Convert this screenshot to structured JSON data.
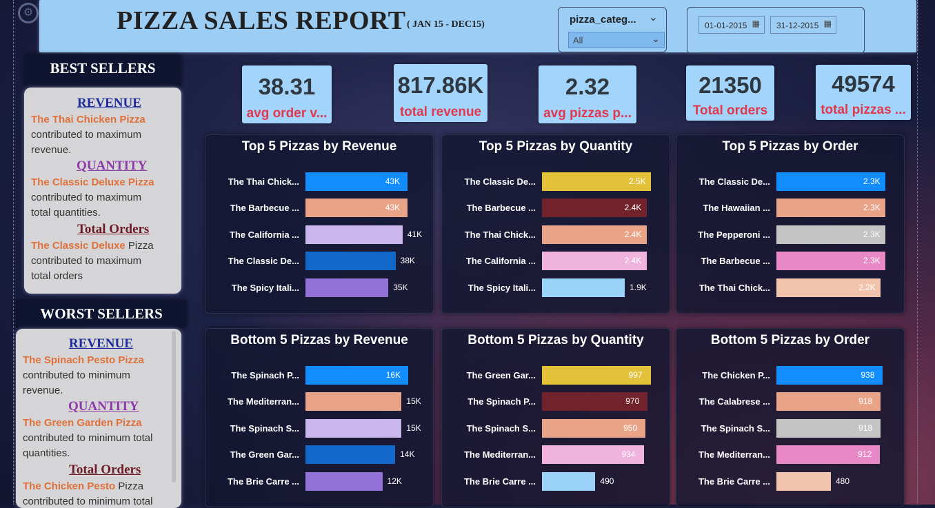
{
  "header": {
    "title": "PIZZA SALES REPORT",
    "subtitle": "( JAN 15 - DEC15)",
    "category_slicer": {
      "label": "pizza_categ...",
      "selected": "All"
    },
    "date_from": "01-01-2015",
    "date_to": "31-12-2015"
  },
  "best_sellers": {
    "heading": "BEST SELLERS",
    "revenue": {
      "title": "REVENUE",
      "name": "The Thai Chicken Pizza",
      "line1": "contributed to maximum",
      "line2": "revenue."
    },
    "quantity": {
      "title": "QUANTITY",
      "name": "The Classic Deluxe Pizza",
      "line1": "contributed to maximum",
      "line2": "total quantities."
    },
    "orders": {
      "title": "Total Orders",
      "name": "The Classic Deluxe",
      "name_suffix": " Pizza",
      "line1": "contributed to maximum",
      "line2": "total orders"
    }
  },
  "worst_sellers": {
    "heading": "WORST SELLERS",
    "revenue": {
      "title": "REVENUE",
      "name": "The Spinach Pesto Pizza",
      "line1": "contributed to minimum",
      "line2": "revenue."
    },
    "quantity": {
      "title": "QUANTITY",
      "name": "The Green Garden Pizza",
      "line1": "contributed to minimum total",
      "line2": "quantities."
    },
    "orders": {
      "title": "Total Orders",
      "name": "The Chicken Pesto",
      "name_suffix": " Pizza",
      "line1": "contributed to minimum total"
    }
  },
  "kpis": [
    {
      "value": "38.31",
      "label": "avg order v..."
    },
    {
      "value": "817.86K",
      "label": "total revenue"
    },
    {
      "value": "2.32",
      "label": "avg pizzas p..."
    },
    {
      "value": "21350",
      "label": "Total orders"
    },
    {
      "value": "49574",
      "label": "total pizzas ..."
    }
  ],
  "chart_data": [
    {
      "type": "bar",
      "title": "Top 5 Pizzas by Revenue",
      "categories": [
        "The Thai Chick...",
        "The Barbecue ...",
        "The California ...",
        "The Classic De...",
        "The Spicy Itali..."
      ],
      "values": [
        43000,
        43000,
        41000,
        38000,
        35000
      ],
      "labels": [
        "43K",
        "43K",
        "41K",
        "38K",
        "35K"
      ],
      "colors": [
        "#118dff",
        "#e9a386",
        "#c8b6ec",
        "#1168c8",
        "#9272d6"
      ],
      "max": 46000
    },
    {
      "type": "bar",
      "title": "Top 5 Pizzas by Quantity",
      "categories": [
        "The Classic De...",
        "The Barbecue ...",
        "The Thai Chick...",
        "The California ...",
        "The Spicy Itali..."
      ],
      "values": [
        2500,
        2400,
        2400,
        2400,
        1900
      ],
      "labels": [
        "2.5K",
        "2.4K",
        "2.4K",
        "2.4K",
        "1.9K"
      ],
      "colors": [
        "#e3c138",
        "#71222a",
        "#e9a386",
        "#f0b3de",
        "#9bd2fa"
      ],
      "max": 2500
    },
    {
      "type": "bar",
      "title": "Top 5 Pizzas by Order",
      "categories": [
        "The Classic De...",
        "The Hawaiian ...",
        "The Pepperoni ...",
        "The Barbecue ...",
        "The Thai Chick..."
      ],
      "values": [
        2300,
        2300,
        2300,
        2300,
        2200
      ],
      "labels": [
        "2.3K",
        "2.3K",
        "2.3K",
        "2.3K",
        "2.2K"
      ],
      "colors": [
        "#118dff",
        "#e9a386",
        "#c4c4c4",
        "#e888c7",
        "#f2c4ae"
      ],
      "max": 2300
    },
    {
      "type": "bar",
      "title": "Bottom 5 Pizzas by Revenue",
      "categories": [
        "The Spinach P...",
        "The Mediterran...",
        "The Spinach S...",
        "The Green Gar...",
        "The Brie Carre ..."
      ],
      "values": [
        16000,
        15000,
        15000,
        14000,
        12000
      ],
      "labels": [
        "16K",
        "15K",
        "15K",
        "14K",
        "12K"
      ],
      "colors": [
        "#118dff",
        "#e9a386",
        "#c8b6ec",
        "#1168c8",
        "#9272d6"
      ],
      "max": 17000
    },
    {
      "type": "bar",
      "title": "Bottom 5 Pizzas by Quantity",
      "categories": [
        "The Green Gar...",
        "The Spinach P...",
        "The Spinach S...",
        "The Mediterran...",
        "The Brie Carre ..."
      ],
      "values": [
        997,
        970,
        950,
        934,
        490
      ],
      "labels": [
        "997",
        "970",
        "950",
        "934",
        "490"
      ],
      "colors": [
        "#e3c138",
        "#71222a",
        "#e9a386",
        "#f0b3de",
        "#9bd2fa"
      ],
      "max": 1000
    },
    {
      "type": "bar",
      "title": "Bottom 5 Pizzas by Order",
      "categories": [
        "The Chicken P...",
        "The Calabrese ...",
        "The Spinach S...",
        "The Mediterran...",
        "The Brie Carre ..."
      ],
      "values": [
        938,
        918,
        918,
        912,
        480
      ],
      "labels": [
        "938",
        "918",
        "918",
        "912",
        "480"
      ],
      "colors": [
        "#118dff",
        "#e9a386",
        "#c4c4c4",
        "#e888c7",
        "#f2c4ae"
      ],
      "max": 960
    }
  ]
}
